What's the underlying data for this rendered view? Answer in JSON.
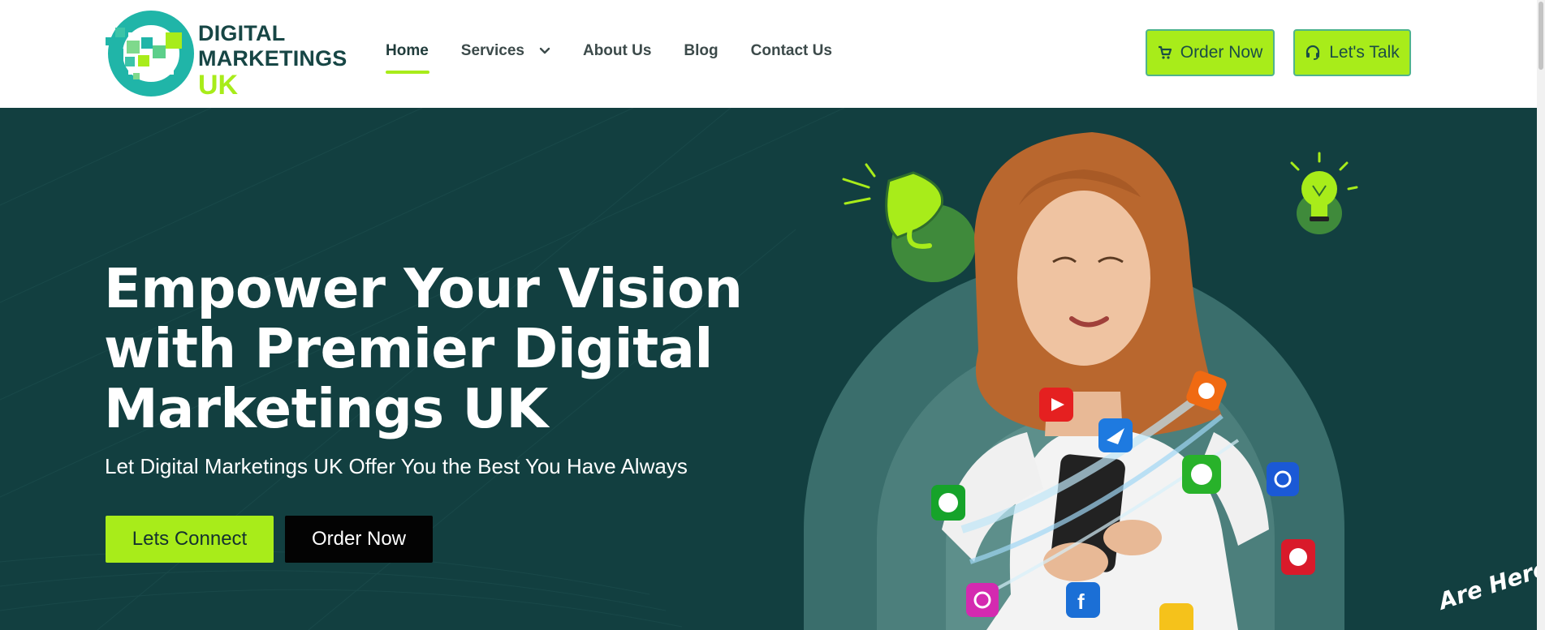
{
  "brand": {
    "line1": "DIGITAL",
    "line2": "MARKETINGS",
    "line3": "UK",
    "colors": {
      "primary": "#174645",
      "accent": "#a8ec1a",
      "teal": "#20b5a8",
      "hero_bg": "#123f40"
    }
  },
  "nav": {
    "items": [
      {
        "label": "Home",
        "active": true
      },
      {
        "label": "Services",
        "has_dropdown": true
      },
      {
        "label": "About Us"
      },
      {
        "label": "Blog"
      },
      {
        "label": "Contact Us"
      }
    ]
  },
  "header_buttons": {
    "order_label": "Order Now",
    "order_icon": "cart-icon",
    "talk_label": "Let's Talk",
    "talk_icon": "headset-icon"
  },
  "hero": {
    "title": "Empower Your Vision with Premier Digital Marketings UK",
    "subtitle": "Let Digital Marketings UK Offer You the Best You Have Always",
    "primary_button": "Lets Connect",
    "secondary_button": "Order Now",
    "arc_text": "Are Here",
    "social_icons": [
      "youtube-icon",
      "blogger-icon",
      "dm-icon",
      "line-icon",
      "quora-icon",
      "spotify-icon",
      "pinterest-icon",
      "facebook-icon",
      "instagram-icon",
      "twitter-icon"
    ]
  }
}
